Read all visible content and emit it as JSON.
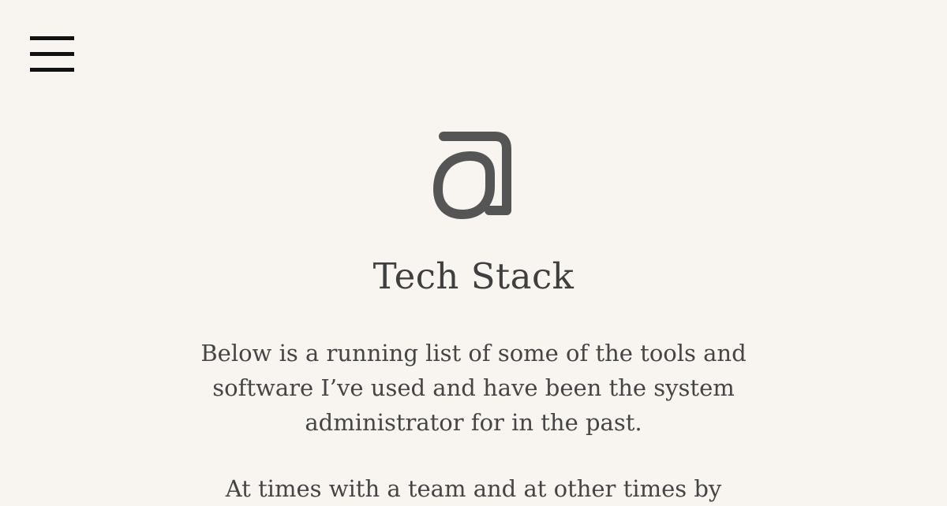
{
  "header": {
    "menu_icon": "hamburger-menu-icon"
  },
  "logo": {
    "icon": "at-sign-logo",
    "color": "#555555"
  },
  "page": {
    "title": "Tech Stack",
    "intro_paragraph": "Below is a running list of some of the tools and software I’ve used and have been the system administrator for in the past.",
    "second_paragraph": "At times with a team and at other times by"
  },
  "colors": {
    "background": "#f8f4ef",
    "text": "#454545",
    "menu": "#111111"
  }
}
